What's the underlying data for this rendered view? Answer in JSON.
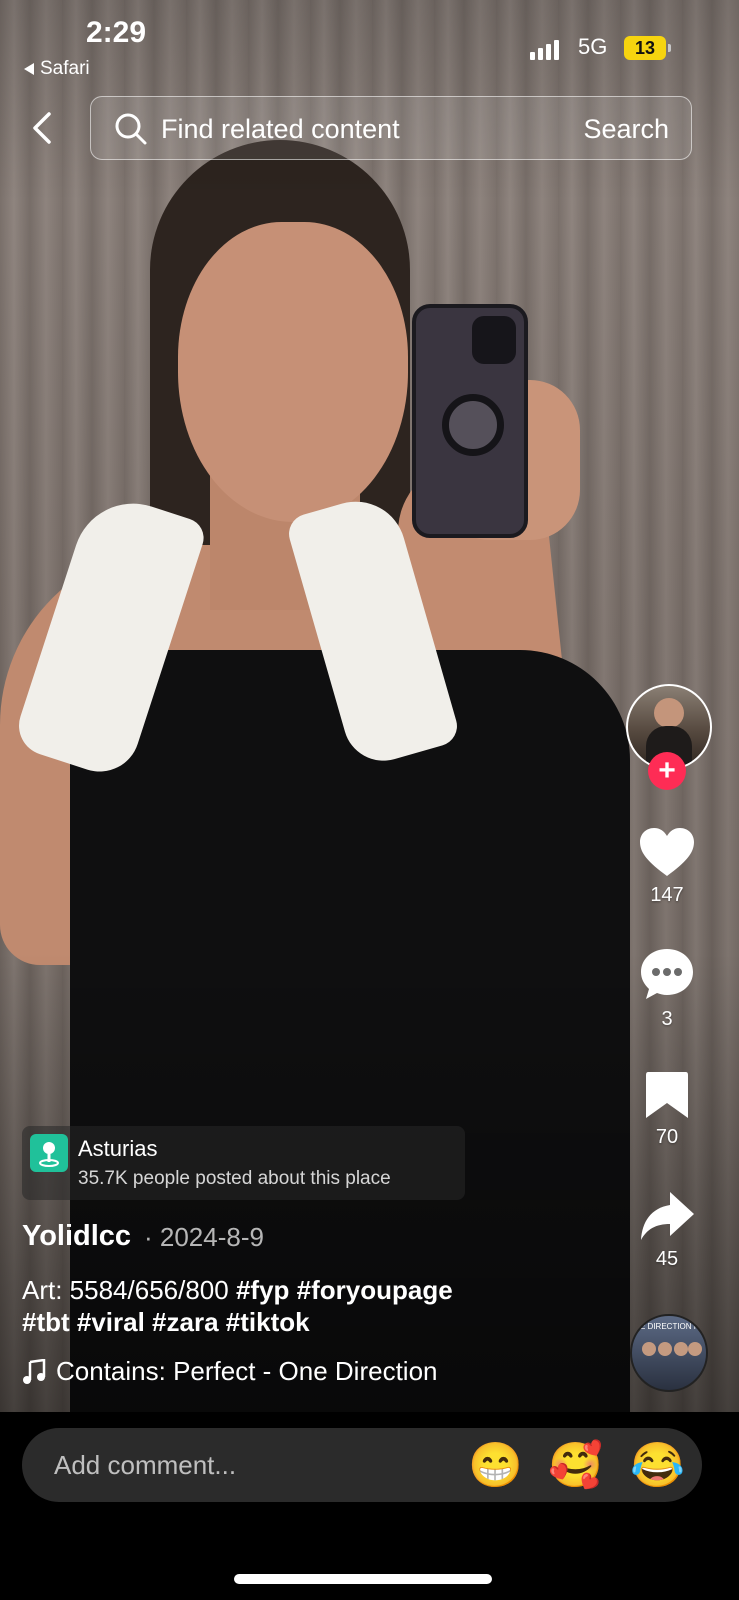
{
  "status_bar": {
    "time": "2:29",
    "back_app": "Safari",
    "network": "5G",
    "battery": "13"
  },
  "search": {
    "placeholder": "Find related content",
    "button": "Search"
  },
  "rail": {
    "likes": "147",
    "comments": "3",
    "saves": "70",
    "shares": "45",
    "follow_symbol": "+"
  },
  "location": {
    "name": "Asturias",
    "subtitle": "35.7K people posted about this place"
  },
  "post": {
    "author": "Yolidlcc",
    "date": "· 2024-8-9",
    "caption_text": "Art: 5584/656/800",
    "hashtags_line1": "#fyp #foryoupage",
    "hashtags_line2": "#tbt #viral #zara #tiktok",
    "sound": "Contains: Perfect - One Direction"
  },
  "music_disc": {
    "label": "E DIRECTION PERF"
  },
  "comment": {
    "placeholder": "Add comment...",
    "emojis": [
      "😁",
      "🥰",
      "😂"
    ]
  },
  "colors": {
    "accent": "#fe2c55",
    "location_pin": "#20c19a",
    "battery": "#f6d40f"
  }
}
